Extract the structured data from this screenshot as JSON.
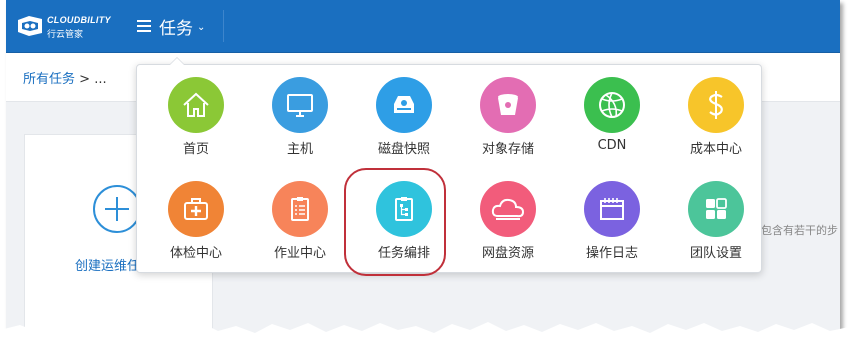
{
  "header": {
    "brand_en": "CLOUDBILITY",
    "brand_cn": "行云管家",
    "menu_title": "任务",
    "accent_color": "#1a6fc0"
  },
  "breadcrumb": {
    "root": "所有任务",
    "separator": ">",
    "current": "..."
  },
  "content": {
    "create_label": "创建运维任",
    "right_hint": "包含有若干的步"
  },
  "apps": [
    {
      "label": "首页",
      "icon": "home-icon",
      "color": "#8bc836"
    },
    {
      "label": "主机",
      "icon": "monitor-icon",
      "color": "#3a9de0"
    },
    {
      "label": "磁盘快照",
      "icon": "disk-icon",
      "color": "#2e9ee6"
    },
    {
      "label": "对象存储",
      "icon": "bucket-icon",
      "color": "#e36db3"
    },
    {
      "label": "CDN",
      "icon": "globe-icon",
      "color": "#3bbf4f"
    },
    {
      "label": "成本中心",
      "icon": "dollar-icon",
      "color": "#f7c52a"
    },
    {
      "label": "体检中心",
      "icon": "medkit-icon",
      "color": "#f08436"
    },
    {
      "label": "作业中心",
      "icon": "clipboard-icon",
      "color": "#f7845a"
    },
    {
      "label": "任务编排",
      "icon": "task-flow-icon",
      "color": "#2fc3dd"
    },
    {
      "label": "网盘资源",
      "icon": "cloud-icon",
      "color": "#f25c7b"
    },
    {
      "label": "操作日志",
      "icon": "calendar-icon",
      "color": "#7b62e0"
    },
    {
      "label": "团队设置",
      "icon": "grid-icon",
      "color": "#4cc59a"
    }
  ]
}
